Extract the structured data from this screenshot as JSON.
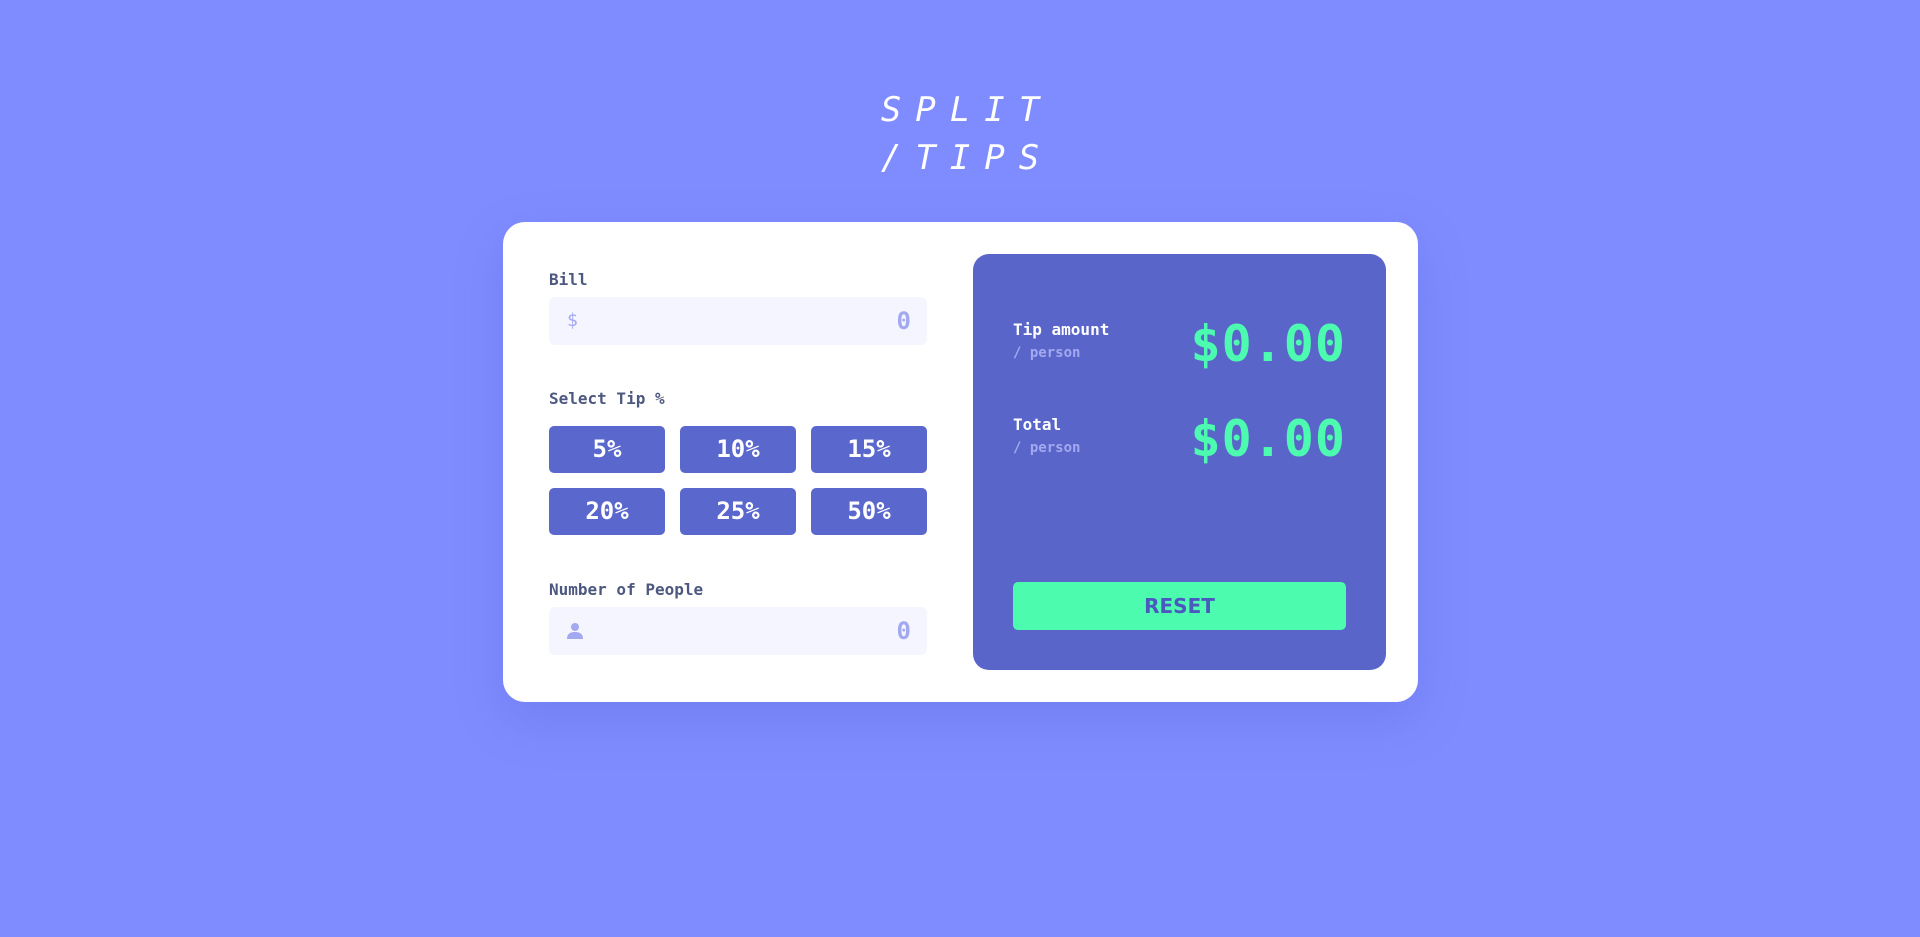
{
  "logo": {
    "line1": "SPLIT",
    "line2": "/TIPS"
  },
  "bill": {
    "label": "Bill",
    "prefix": "$",
    "placeholder": "0"
  },
  "tip": {
    "label": "Select Tip %",
    "options": [
      "5%",
      "10%",
      "15%",
      "20%",
      "25%",
      "50%"
    ]
  },
  "people": {
    "label": "Number of People",
    "icon": "person-icon",
    "placeholder": "0"
  },
  "results": {
    "tip_amount": {
      "title": "Tip amount",
      "sub": "/ person",
      "value": "$0.00"
    },
    "total": {
      "title": "Total",
      "sub": "/ person",
      "value": "$0.00"
    },
    "reset_label": "RESET"
  },
  "colors": {
    "background": "#7f8cff",
    "card": "#ffffff",
    "panel": "#5a65c9",
    "tip_button": "#5a67cd",
    "accent": "#4dfbb0",
    "label": "#4d5880",
    "muted": "#a3a9f0"
  }
}
